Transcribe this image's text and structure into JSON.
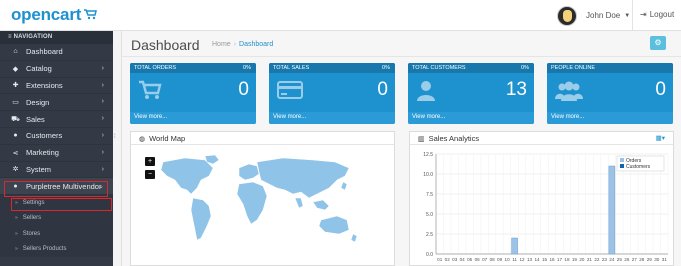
{
  "header": {
    "logo_text": "opencart",
    "user_name": "John Doe",
    "logout_label": "Logout"
  },
  "sidebar": {
    "heading": "NAVIGATION",
    "items": [
      {
        "label": "Dashboard",
        "icon": "dashboard-icon",
        "glyph": "⌂",
        "chevron": false
      },
      {
        "label": "Catalog",
        "icon": "tag-icon",
        "glyph": "◆",
        "chevron": true
      },
      {
        "label": "Extensions",
        "icon": "puzzle-icon",
        "glyph": "✚",
        "chevron": true
      },
      {
        "label": "Design",
        "icon": "monitor-icon",
        "glyph": "▭",
        "chevron": true
      },
      {
        "label": "Sales",
        "icon": "cart-icon",
        "glyph": "⛟",
        "chevron": true
      },
      {
        "label": "Customers",
        "icon": "user-icon",
        "glyph": "●",
        "chevron": true
      },
      {
        "label": "Marketing",
        "icon": "share-icon",
        "glyph": "⋖",
        "chevron": true
      },
      {
        "label": "System",
        "icon": "cog-icon",
        "glyph": "✲",
        "chevron": true
      },
      {
        "label": "Purpletree Multivendor",
        "icon": "user-icon",
        "glyph": "●",
        "chevron": false,
        "expanded": true
      }
    ],
    "subitems": [
      "Settings",
      "Sellers",
      "Stores",
      "Sellers Products"
    ]
  },
  "main": {
    "title": "Dashboard",
    "breadcrumb": [
      "Home",
      "Dashboard"
    ],
    "accent": "#1e91cf"
  },
  "tiles": [
    {
      "label": "TOTAL ORDERS",
      "pct": "0%",
      "value": "0",
      "link": "View more...",
      "icon": "cart-icon"
    },
    {
      "label": "TOTAL SALES",
      "pct": "0%",
      "value": "0",
      "link": "View more...",
      "icon": "credit-card-icon"
    },
    {
      "label": "TOTAL CUSTOMERS",
      "pct": "0%",
      "value": "13",
      "link": "View more...",
      "icon": "user-icon"
    },
    {
      "label": "PEOPLE ONLINE",
      "pct": "",
      "value": "0",
      "link": "View more...",
      "icon": "users-icon"
    }
  ],
  "panels": {
    "map_title": "World Map",
    "map_zoom_in": "+",
    "map_zoom_out": "−",
    "analytics_title": "Sales Analytics"
  },
  "chart_data": {
    "type": "bar",
    "ylim": [
      0,
      12.5
    ],
    "yticks": [
      "0.0",
      "2.5",
      "5.0",
      "7.5",
      "10.0",
      "12.5"
    ],
    "categories": [
      "01",
      "02",
      "03",
      "04",
      "05",
      "06",
      "07",
      "08",
      "09",
      "10",
      "11",
      "12",
      "13",
      "14",
      "15",
      "16",
      "17",
      "18",
      "19",
      "20",
      "21",
      "22",
      "23",
      "24",
      "25",
      "26",
      "27",
      "28",
      "29",
      "30",
      "31"
    ],
    "series": [
      {
        "name": "Orders",
        "color": "#9cc3e6",
        "values": [
          0,
          0,
          0,
          0,
          0,
          0,
          0,
          0,
          0,
          0,
          2,
          0,
          0,
          0,
          0,
          0,
          0,
          0,
          0,
          0,
          0,
          0,
          0,
          11,
          0,
          0,
          0,
          0,
          0,
          0,
          0
        ]
      },
      {
        "name": "Customers",
        "color": "#1065b3",
        "values": [
          0,
          0,
          0,
          0,
          0,
          0,
          0,
          0,
          0,
          0,
          0,
          0,
          0,
          0,
          0,
          0,
          0,
          0,
          0,
          0,
          0,
          0,
          0,
          0,
          0,
          0,
          0,
          0,
          0,
          0,
          0
        ]
      }
    ],
    "grid": true,
    "legend": "top-right"
  }
}
